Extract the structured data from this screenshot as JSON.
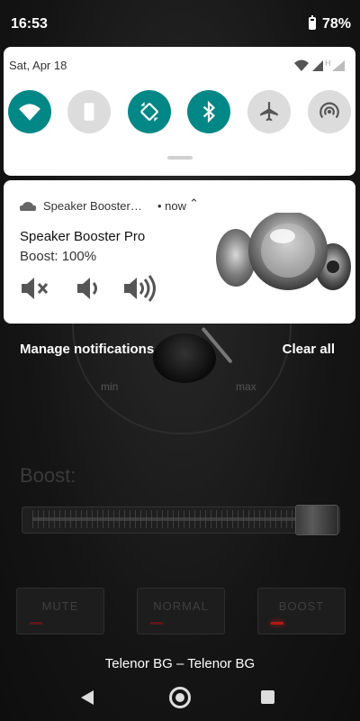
{
  "status_bar": {
    "time": "16:53",
    "battery": "78%"
  },
  "quick_settings": {
    "date": "Sat, Apr 18",
    "network_type": "H",
    "tiles": [
      {
        "id": "wifi",
        "state": "on"
      },
      {
        "id": "auto-rotate-off",
        "state": "off"
      },
      {
        "id": "auto-rotate",
        "state": "on"
      },
      {
        "id": "bluetooth",
        "state": "on"
      },
      {
        "id": "airplane-mode",
        "state": "off"
      },
      {
        "id": "hotspot",
        "state": "off"
      }
    ],
    "colors": {
      "accent": "#018786",
      "off": "#dcdcdc"
    }
  },
  "notification": {
    "app_name": "Speaker Booster…",
    "time": "• now",
    "expand_icon": "chevron-up-icon",
    "title": "Speaker Booster Pro",
    "text": "Boost: 100%",
    "actions": [
      "mute-icon",
      "volume-low-icon",
      "volume-high-icon"
    ]
  },
  "shade_actions": {
    "manage": "Manage notifications",
    "clear": "Clear all"
  },
  "background_app": {
    "dial_min": "min",
    "dial_max": "max",
    "boost_label": "Boost:",
    "boost_level": 1.0,
    "buttons": [
      "MUTE",
      "NORMAL",
      "BOOST"
    ],
    "active_button": "BOOST"
  },
  "carrier": "Telenor BG – Telenor BG"
}
